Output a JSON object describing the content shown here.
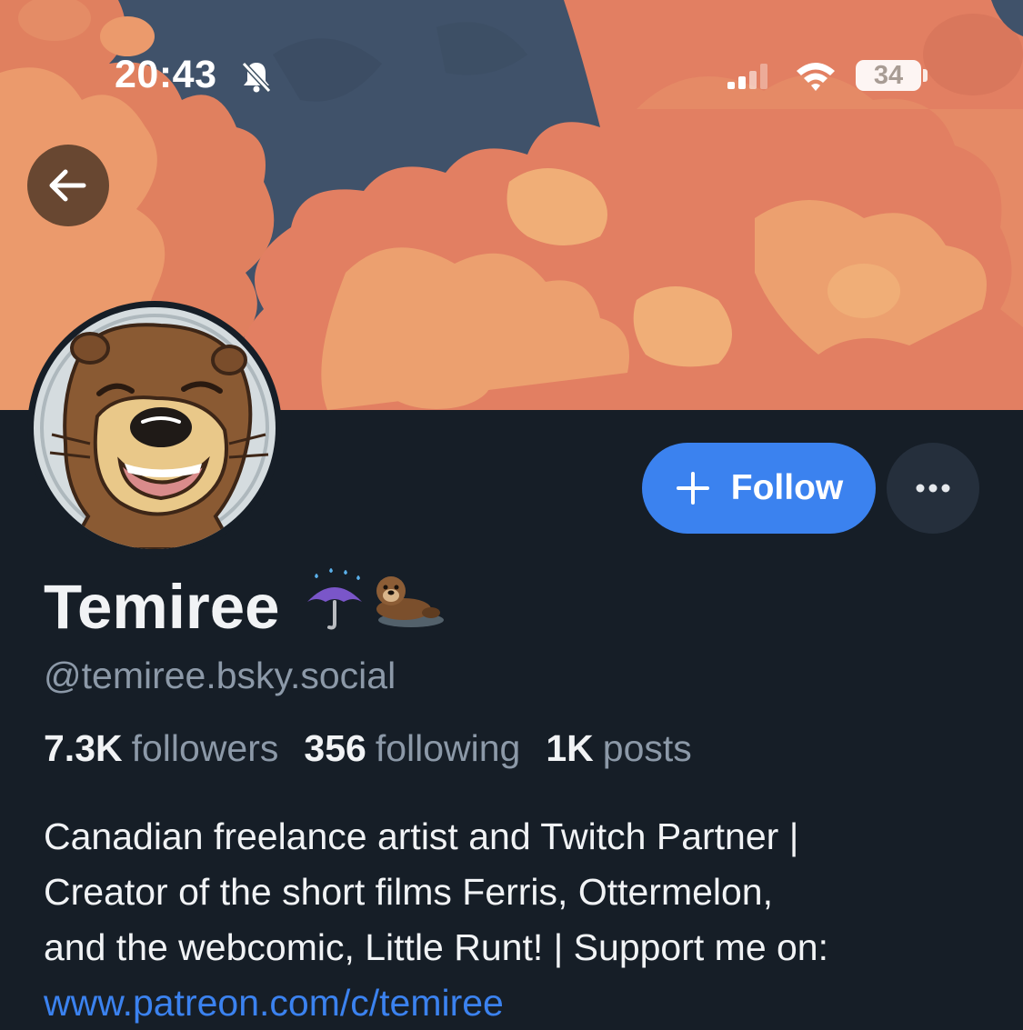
{
  "status_bar": {
    "time": "20:43",
    "battery_level": "34",
    "icons": [
      "bell-slash-icon",
      "signal-icon",
      "wifi-icon",
      "battery-icon"
    ]
  },
  "navigation": {
    "back_icon": "arrow-left-icon"
  },
  "profile": {
    "display_name": "Temiree",
    "name_emoji": "☔🦦",
    "handle": "@temiree.bsky.social",
    "stats": [
      {
        "value": "7.3K",
        "label": "followers"
      },
      {
        "value": "356",
        "label": "following"
      },
      {
        "value": "1K",
        "label": "posts"
      }
    ],
    "bio_lines": [
      "Canadian freelance artist and Twitch Partner |",
      "Creator of the short films Ferris, Ottermelon,",
      "and the webcomic, Little Runt! | Support me on:"
    ],
    "bio_link": "www.patreon.com/c/temiree"
  },
  "actions": {
    "follow_label": "Follow",
    "follow_icon": "plus-icon",
    "more_icon": "ellipsis-icon"
  },
  "colors": {
    "background": "#161e27",
    "accent": "#3b82ef",
    "text_primary": "#f1f3f5",
    "text_secondary": "#8c99a8",
    "banner_sky": "#3f5263",
    "banner_cloud": "#e27f62",
    "banner_cloud_light": "#efa873"
  }
}
